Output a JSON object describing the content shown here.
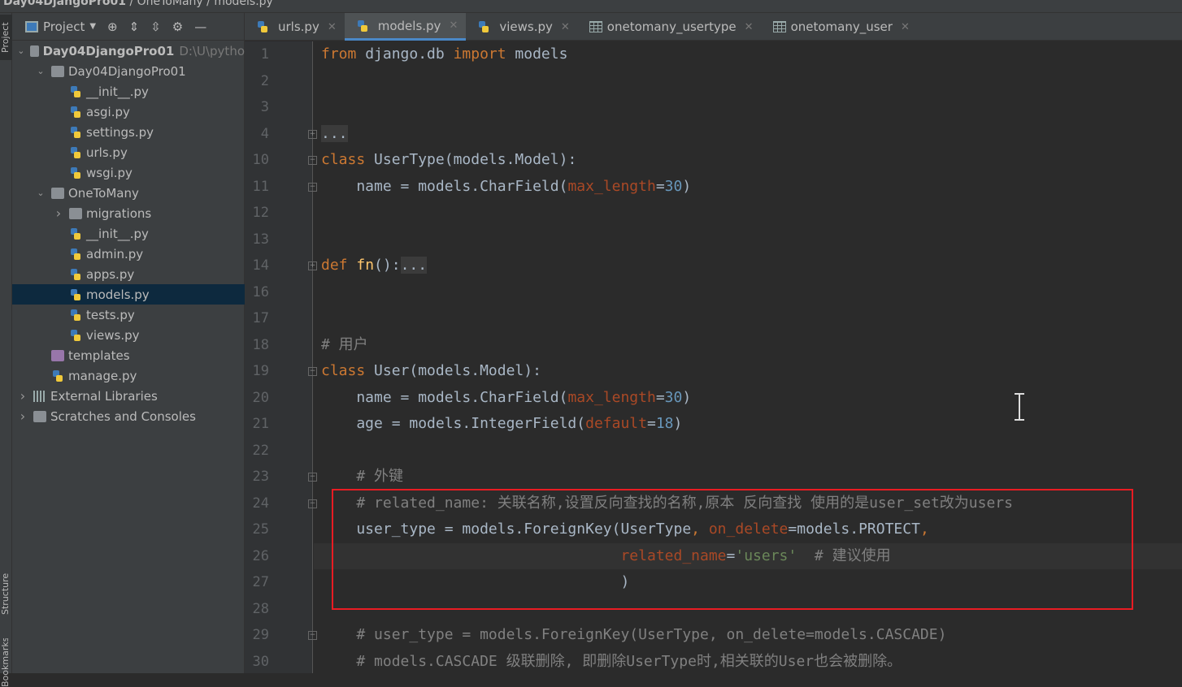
{
  "breadcrumb": [
    "Day04DjangoPro01",
    "OneToMany",
    "models.py"
  ],
  "left_strip": {
    "project": "Project",
    "structure": "Structure",
    "bookmarks": "Bookmarks"
  },
  "sidebar": {
    "title": "Project",
    "tree": [
      {
        "label": "Day04DjangoPro01",
        "extra": "D:\\U\\pytho",
        "depth": 0,
        "type": "folder",
        "arrow": "down",
        "bold": true
      },
      {
        "label": "Day04DjangoPro01",
        "depth": 1,
        "type": "folder",
        "arrow": "down"
      },
      {
        "label": "__init__.py",
        "depth": 2,
        "type": "py"
      },
      {
        "label": "asgi.py",
        "depth": 2,
        "type": "py"
      },
      {
        "label": "settings.py",
        "depth": 2,
        "type": "py"
      },
      {
        "label": "urls.py",
        "depth": 2,
        "type": "py"
      },
      {
        "label": "wsgi.py",
        "depth": 2,
        "type": "py"
      },
      {
        "label": "OneToMany",
        "depth": 1,
        "type": "folder",
        "arrow": "down"
      },
      {
        "label": "migrations",
        "depth": 2,
        "type": "folder",
        "arrow": "right"
      },
      {
        "label": "__init__.py",
        "depth": 2,
        "type": "py"
      },
      {
        "label": "admin.py",
        "depth": 2,
        "type": "py"
      },
      {
        "label": "apps.py",
        "depth": 2,
        "type": "py"
      },
      {
        "label": "models.py",
        "depth": 2,
        "type": "py",
        "selected": true
      },
      {
        "label": "tests.py",
        "depth": 2,
        "type": "py"
      },
      {
        "label": "views.py",
        "depth": 2,
        "type": "py"
      },
      {
        "label": "templates",
        "depth": 1,
        "type": "folder-purple"
      },
      {
        "label": "manage.py",
        "depth": 1,
        "type": "py"
      },
      {
        "label": "External Libraries",
        "depth": 0,
        "type": "lib",
        "arrow": "right"
      },
      {
        "label": "Scratches and Consoles",
        "depth": 0,
        "type": "scratch",
        "arrow": "right"
      }
    ]
  },
  "tabs": [
    {
      "label": "urls.py",
      "icon": "python-file-icon"
    },
    {
      "label": "models.py",
      "icon": "python-file-icon",
      "active": true
    },
    {
      "label": "views.py",
      "icon": "python-file-icon"
    },
    {
      "label": "onetomany_usertype",
      "icon": "table-icon"
    },
    {
      "label": "onetomany_user",
      "icon": "table-icon"
    }
  ],
  "code": [
    {
      "n": "1",
      "t": [
        [
          "kw",
          "from "
        ],
        [
          "tx",
          "django.db "
        ],
        [
          "kw",
          "import "
        ],
        [
          "tx",
          "models"
        ]
      ]
    },
    {
      "n": "2",
      "t": []
    },
    {
      "n": "3",
      "t": []
    },
    {
      "n": "4",
      "fold": "+",
      "t": [
        [
          "fd",
          "..."
        ]
      ]
    },
    {
      "n": "10",
      "fold": "-",
      "t": [
        [
          "kw",
          "class "
        ],
        [
          "tx",
          "UserType(models.Model):"
        ]
      ]
    },
    {
      "n": "11",
      "fold": "-",
      "t": [
        [
          "tx",
          "    name = models.CharField("
        ],
        [
          "pa",
          "max_length"
        ],
        [
          "tx",
          "="
        ],
        [
          "nu",
          "30"
        ],
        [
          "tx",
          ")"
        ]
      ]
    },
    {
      "n": "12",
      "t": []
    },
    {
      "n": "13",
      "t": []
    },
    {
      "n": "14",
      "fold": "+",
      "t": [
        [
          "kw",
          "def "
        ],
        [
          "fn",
          "fn"
        ],
        [
          "tx",
          "():"
        ],
        [
          "fd",
          "..."
        ]
      ]
    },
    {
      "n": "16",
      "t": []
    },
    {
      "n": "17",
      "t": []
    },
    {
      "n": "18",
      "t": [
        [
          "cm",
          "# 用户"
        ]
      ]
    },
    {
      "n": "19",
      "fold": "-",
      "t": [
        [
          "kw",
          "class "
        ],
        [
          "tx",
          "User(models.Model):"
        ]
      ]
    },
    {
      "n": "20",
      "t": [
        [
          "tx",
          "    name = models.CharField("
        ],
        [
          "pa",
          "max_length"
        ],
        [
          "tx",
          "="
        ],
        [
          "nu",
          "30"
        ],
        [
          "tx",
          ")"
        ]
      ]
    },
    {
      "n": "21",
      "t": [
        [
          "tx",
          "    age = models.IntegerField("
        ],
        [
          "pa",
          "default"
        ],
        [
          "tx",
          "="
        ],
        [
          "nu",
          "18"
        ],
        [
          "tx",
          ")"
        ]
      ]
    },
    {
      "n": "22",
      "t": []
    },
    {
      "n": "23",
      "fold": "-",
      "t": [
        [
          "cm",
          "    # 外键"
        ]
      ]
    },
    {
      "n": "24",
      "fold": "-",
      "t": [
        [
          "cm",
          "    # related_name: 关联名称,设置反向查找的名称,原本 反向查找 使用的是user_set改为users"
        ]
      ]
    },
    {
      "n": "25",
      "t": [
        [
          "tx",
          "    user_type = models.ForeignKey(UserType"
        ],
        [
          "kw",
          ", "
        ],
        [
          "pa",
          "on_delete"
        ],
        [
          "tx",
          "=models.PROTECT"
        ],
        [
          "kw",
          ","
        ]
      ]
    },
    {
      "n": "26",
      "current": true,
      "t": [
        [
          "tx",
          "                                  "
        ],
        [
          "pa",
          "related_name"
        ],
        [
          "tx",
          "="
        ],
        [
          "st",
          "'users'"
        ],
        [
          "tx",
          "  "
        ],
        [
          "cm",
          "# 建议使用"
        ]
      ]
    },
    {
      "n": "27",
      "t": [
        [
          "tx",
          "                                  )"
        ]
      ]
    },
    {
      "n": "28",
      "t": []
    },
    {
      "n": "29",
      "fold": "-",
      "t": [
        [
          "cm",
          "    # user_type = models.ForeignKey(UserType, on_delete=models.CASCADE)"
        ]
      ]
    },
    {
      "n": "30",
      "t": [
        [
          "cm",
          "    # models.CASCADE 级联删除, 即删除UserType时,相关联的User也会被删除。"
        ]
      ]
    }
  ],
  "colors": {
    "keyword": "#cc7832",
    "text": "#a9b7c6",
    "param": "#aa4926",
    "number": "#6897bb",
    "string": "#6a8759",
    "comment": "#808080",
    "highlight_box": "#e81c23"
  }
}
